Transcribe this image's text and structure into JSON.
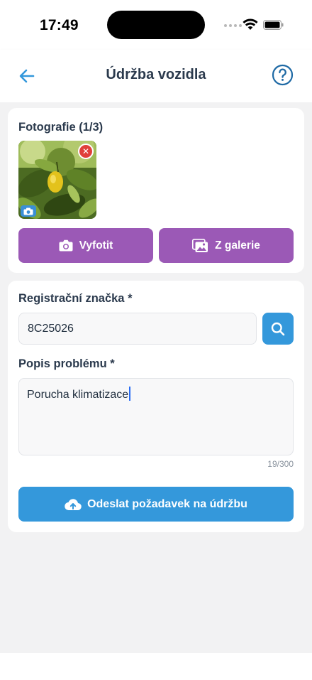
{
  "status_bar": {
    "time": "17:49"
  },
  "header": {
    "title": "Údržba vozidla"
  },
  "photos": {
    "label": "Fotografie (1/3)",
    "remove_symbol": "✕",
    "take_photo_label": "Vyfotit",
    "gallery_label": "Z galerie"
  },
  "form": {
    "plate_label": "Registrační značka *",
    "plate_value": "8C25026",
    "description_label": "Popis problému *",
    "description_value": "Porucha klimatizace",
    "char_count": "19/300",
    "submit_label": "Odeslat požadavek na údržbu"
  },
  "colors": {
    "accent_blue": "#3498db",
    "accent_purple": "#9b59b6",
    "danger_red": "#e0403a",
    "background": "#f2f2f3"
  },
  "icons": [
    "back-arrow-icon",
    "help-circle-icon",
    "camera-icon",
    "gallery-icon",
    "search-icon",
    "cloud-upload-icon",
    "close-icon",
    "wifi-icon",
    "battery-icon",
    "signal-icon"
  ]
}
